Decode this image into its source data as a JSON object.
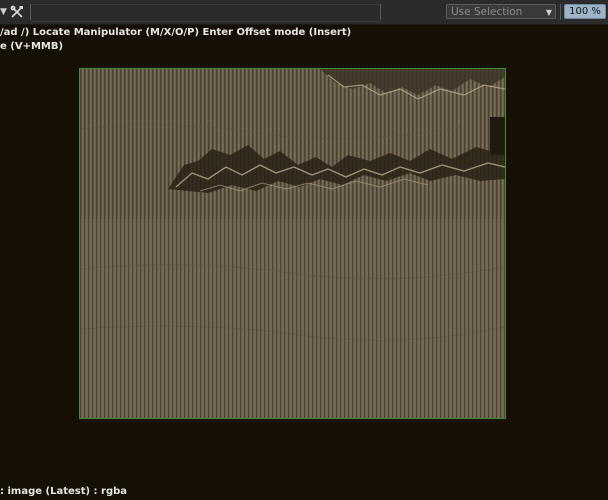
{
  "toolbar": {
    "chevron_icon": "chevron-down-icon",
    "tools_icon": "tools-icon",
    "selection_mode": "Use Selection",
    "zoom": "100 %"
  },
  "viewport": {
    "hint_line1": "/ad /)  Locate Manipulator (M/X/O/P)  Enter Offset mode (Insert)",
    "hint_line2": "e (V+MMB)",
    "status": ": image (Latest) : rgba",
    "frame_color": "#3d8f32",
    "background_color": "#150f04"
  }
}
